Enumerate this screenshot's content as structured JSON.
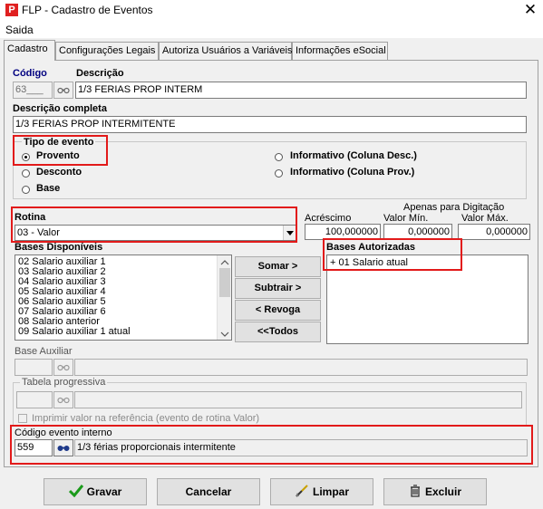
{
  "window": {
    "title": "FLP - Cadastro de Eventos",
    "icon_letter": "P",
    "close_glyph": "✕"
  },
  "menu": {
    "items": [
      "Saida"
    ]
  },
  "tabs": [
    "Cadastro",
    "Configurações Legais",
    "Autoriza Usuários a Variáveis",
    "Informações eSocial"
  ],
  "codigo": {
    "label": "Código",
    "value": "63___"
  },
  "descricao": {
    "label": "Descrição",
    "value": "1/3 FERIAS PROP INTERM"
  },
  "descricao_completa": {
    "label": "Descrição completa",
    "value": "1/3 FERIAS PROP INTERMITENTE"
  },
  "tipo_evento": {
    "label": "Tipo de evento",
    "options": [
      "Provento",
      "Desconto",
      "Base",
      "Informativo (Coluna Desc.)",
      "Informativo (Coluna Prov.)"
    ],
    "selected": "Provento"
  },
  "rotina": {
    "label": "Rotina",
    "value": "03 - Valor"
  },
  "digitacao": {
    "header": "Apenas para Digitação",
    "acrescimo_label": "Acréscimo",
    "acrescimo_value": "100,000000",
    "valor_min_label": "Valor Mín.",
    "valor_min_value": "0,000000",
    "valor_max_label": "Valor Máx.",
    "valor_max_value": "0,000000"
  },
  "bases_disponiveis": {
    "label": "Bases Disponíveis",
    "items": [
      "02 Salario auxiliar 1",
      "03 Salario auxiliar 2",
      "04 Salario auxiliar 3",
      "05 Salario auxiliar 4",
      "06 Salario auxiliar 5",
      "07 Salario auxiliar 6",
      "08 Salario anterior",
      "09 Salario auxiliar 1 atual"
    ]
  },
  "bases_autorizadas": {
    "label": "Bases Autorizadas",
    "items": [
      "+ 01 Salario atual"
    ]
  },
  "buttons": {
    "somar": "Somar >",
    "subtrair": "Subtrair >",
    "revoga": "< Revoga",
    "todos": "<<Todos"
  },
  "base_auxiliar": {
    "label": "Base Auxiliar",
    "value": ""
  },
  "tabela_progressiva": {
    "label": "Tabela progressiva",
    "value": ""
  },
  "imprimir": {
    "label": "Imprimir valor na referência (evento de rotina Valor)",
    "checked": false
  },
  "codigo_interno": {
    "label": "Código evento interno",
    "code": "559",
    "description": "1/3 férias proporcionais intermitente"
  },
  "footer": {
    "gravar": "Gravar",
    "cancelar": "Cancelar",
    "limpar": "Limpar",
    "excluir": "Excluir"
  },
  "colors": {
    "highlight": "#e21a1a",
    "check_green": "#1a9a1a",
    "label_blue": "#000080"
  }
}
